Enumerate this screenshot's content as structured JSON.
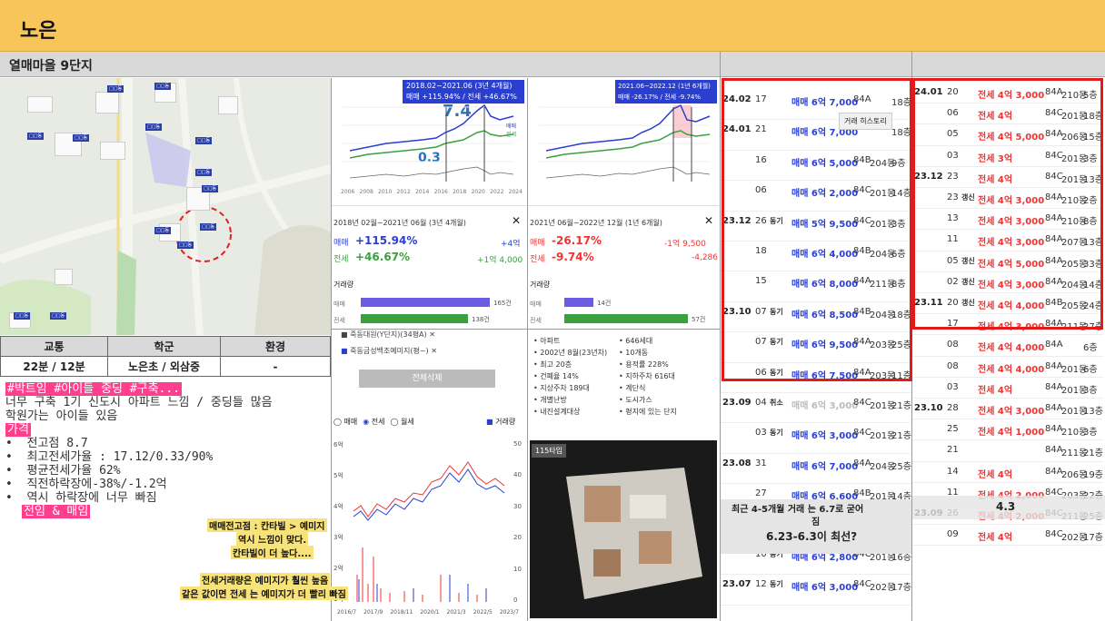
{
  "header": {
    "title": "노은"
  },
  "subbar": {
    "title": "열매마을 9단지"
  },
  "info_table": {
    "headers": [
      "교통",
      "학군",
      "환경"
    ],
    "values": [
      "22분 / 12분",
      "노은초 / 외삼중",
      "-"
    ]
  },
  "notes": {
    "tags": "#박트임 #아이들 중딩 #구축...",
    "line1": "너무 구축 1기 신도시 아파트 느낌 / 중딩들 많음",
    "line2": "학원가는 아이들 있음",
    "price_label": "가격",
    "bullets": [
      "전고점 8.7",
      "최고전세가율 : 17.12/0.33/90%",
      "평균전세가율 62%",
      "직전하락장에-38%/-1.2억",
      "역시 하락장에 너무 빠짐"
    ],
    "highlight": "전임 & 매임",
    "yellow1": "매매전고점 : 칸타빌 > 예미지",
    "yellow2": "역시 느낌이 맞다.",
    "yellow3": "칸타빌이 더 높다....",
    "yellow4": "전세거래량은 예미지가 훨씬 높음",
    "yellow5": "같은 값이면 전세 는 예미지가 더 빨리 빠짐"
  },
  "chart1": {
    "banner1": "2018.02~2021.06 (3년 4개월)",
    "banner2": "매매 +115.94% / 전세 +46.67%",
    "big1": "7.4",
    "big2": "0.3",
    "legend": [
      "매매",
      "전세"
    ],
    "xticks": [
      "2006",
      "2008",
      "2010",
      "2012",
      "2014",
      "2016",
      "2018",
      "2020",
      "2022",
      "2024"
    ],
    "period": "2018년 02월~2021년 06월 (3년 4개월)",
    "close": "✕",
    "sale_label": "매매",
    "sale_pct": "+115.94%",
    "sale_amt": "+4억",
    "rent_label": "전세",
    "rent_pct": "+46.67%",
    "rent_amt": "+1억 4,000",
    "volume_title": "거래량",
    "vol_sale": "165건",
    "vol_rent": "138건"
  },
  "chart2": {
    "banner1": "2021.06~2022.12 (1년 6개월)",
    "banner2": "매매 -26.17% / 전세 -9.74%",
    "period": "2021년 06월~2022년 12월 (1년 6개월)",
    "close": "✕",
    "sale_label": "매매",
    "sale_pct": "-26.17%",
    "sale_amt": "-1억 9,500",
    "rent_label": "전세",
    "rent_pct": "-9.74%",
    "rent_amt": "-4,286",
    "volume_title": "거래량",
    "vol_sale": "14건",
    "vol_rent": "57건"
  },
  "search_panel": {
    "chips": [
      "죽동대원(Y단지)(34평A) ✕",
      "죽동금성백조예미지(평~) ✕"
    ],
    "delete_all": "전체삭제",
    "radios": [
      "매매",
      "전세",
      "월세"
    ],
    "volume_check": "거래량",
    "yticks": [
      "6억",
      "5억",
      "4억",
      "3억",
      "2억",
      "1억"
    ],
    "yticks_r": [
      "50",
      "40",
      "30",
      "20",
      "10",
      "0"
    ],
    "xticks": [
      "2016/7",
      "2017/9",
      "2018/11",
      "2020/1",
      "2021/3",
      "2022/5",
      "2023/7"
    ]
  },
  "apt_info": {
    "left": [
      "아파트",
      "2002년 8월(23년차)",
      "최고 20층",
      "건폐율 14%",
      "지상주차 189대",
      "개별난방",
      "내진설계대상"
    ],
    "right": [
      "646세대",
      "10개동",
      "용적률 228%",
      "지하주차 616대",
      "계단식",
      "도시가스",
      "평지에 있는 단지"
    ],
    "plan_badge": "115타입"
  },
  "deals_left": {
    "tooltip": "거래 히스토리",
    "rows": [
      {
        "ym": "24.02",
        "d": "17",
        "tag": "",
        "price": "매매 6억 7,000",
        "type": "84A",
        "dong": "",
        "floor": "18층"
      },
      {
        "ym": "24.01",
        "d": "21",
        "tag": "",
        "price": "매매 6억 7,000",
        "type": "",
        "dong": "",
        "floor": "18층"
      },
      {
        "ym": "",
        "d": "16",
        "tag": "",
        "price": "매매 6억 5,000",
        "type": "84B",
        "dong": "204동",
        "floor": "9층"
      },
      {
        "ym": "",
        "d": "06",
        "tag": "",
        "price": "매매 6억 2,000",
        "type": "84C",
        "dong": "201동",
        "floor": "14층"
      },
      {
        "ym": "23.12",
        "d": "26",
        "tag": "동기",
        "price": "매매 5억 9,500",
        "type": "84C",
        "dong": "201동",
        "floor": "3층"
      },
      {
        "ym": "",
        "d": "18",
        "tag": "",
        "price": "매매 6억 4,000",
        "type": "84B",
        "dong": "204동",
        "floor": "6층"
      },
      {
        "ym": "",
        "d": "15",
        "tag": "",
        "price": "매매 6억 8,000",
        "type": "84A",
        "dong": "211동",
        "floor": "8층"
      },
      {
        "ym": "23.10",
        "d": "07",
        "tag": "동기",
        "price": "매매 6억 8,500",
        "type": "84B",
        "dong": "204동",
        "floor": "18층"
      },
      {
        "ym": "",
        "d": "07",
        "tag": "동기",
        "price": "매매 6억 9,500",
        "type": "84A",
        "dong": "203동",
        "floor": "25층"
      },
      {
        "ym": "",
        "d": "06",
        "tag": "동기",
        "price": "매매 6억 7,500",
        "type": "84A",
        "dong": "203동",
        "floor": "11층"
      },
      {
        "ym": "23.09",
        "d": "04",
        "tag": "취소",
        "price": "매매 6억 3,000",
        "type": "84C",
        "dong": "201동",
        "floor": "21층"
      },
      {
        "ym": "",
        "d": "03",
        "tag": "동기",
        "price": "매매 6억 3,000",
        "type": "84C",
        "dong": "201동",
        "floor": "21층"
      },
      {
        "ym": "23.08",
        "d": "31",
        "tag": "",
        "price": "매매 6억 7,000",
        "type": "84A",
        "dong": "204동",
        "floor": "25층"
      },
      {
        "ym": "",
        "d": "27",
        "tag": "",
        "price": "매매 6억 6,600",
        "type": "84B",
        "dong": "201동",
        "floor": "14층"
      },
      {
        "ym": "",
        "d": "",
        "tag": "",
        "price": "",
        "type": "",
        "dong": "211동",
        "floor": "5층"
      },
      {
        "ym": "",
        "d": "10",
        "tag": "동기",
        "price": "매매 6억 2,800",
        "type": "84C",
        "dong": "201동",
        "floor": "16층"
      },
      {
        "ym": "23.07",
        "d": "12",
        "tag": "동기",
        "price": "매매 6억 3,000",
        "type": "84C",
        "dong": "202동",
        "floor": "17층"
      }
    ],
    "note1": "최근 4-5개월 거래 는 6.7로 굳어",
    "note2": "짐",
    "note3": "6.23-6.3이 최선?"
  },
  "deals_right": {
    "rows": [
      {
        "ym": "24.01",
        "d": "20",
        "tag": "",
        "price": "전세 4억 3,000",
        "type": "84A",
        "dong": "210동",
        "floor": "5층"
      },
      {
        "ym": "",
        "d": "06",
        "tag": "",
        "price": "전세 4억",
        "type": "84C",
        "dong": "201동",
        "floor": "18층"
      },
      {
        "ym": "",
        "d": "05",
        "tag": "",
        "price": "전세 4억 5,000",
        "type": "84A",
        "dong": "206동",
        "floor": "15층"
      },
      {
        "ym": "",
        "d": "03",
        "tag": "",
        "price": "전세 3억",
        "type": "84C",
        "dong": "201동",
        "floor": "3층"
      },
      {
        "ym": "23.12",
        "d": "23",
        "tag": "",
        "price": "전세 4억",
        "type": "84C",
        "dong": "201동",
        "floor": "13층"
      },
      {
        "ym": "",
        "d": "23",
        "tag": "갱신",
        "price": "전세 4억 3,000",
        "type": "84A",
        "dong": "210동",
        "floor": "2층"
      },
      {
        "ym": "",
        "d": "13",
        "tag": "",
        "price": "전세 4억 3,000",
        "type": "84A",
        "dong": "210동",
        "floor": "8층"
      },
      {
        "ym": "",
        "d": "11",
        "tag": "",
        "price": "전세 4억 3,000",
        "type": "84A",
        "dong": "207동",
        "floor": "13층"
      },
      {
        "ym": "",
        "d": "05",
        "tag": "갱신",
        "price": "전세 4억 5,000",
        "type": "84A",
        "dong": "205동",
        "floor": "33층"
      },
      {
        "ym": "",
        "d": "02",
        "tag": "갱신",
        "price": "전세 4억 3,000",
        "type": "84A",
        "dong": "204동",
        "floor": "14층"
      },
      {
        "ym": "23.11",
        "d": "20",
        "tag": "갱신",
        "price": "전세 4억 4,000",
        "type": "84B",
        "dong": "205동",
        "floor": "24층"
      },
      {
        "ym": "",
        "d": "17",
        "tag": "",
        "price": "전세 4억 3,000",
        "type": "84A",
        "dong": "211동",
        "floor": "27층"
      },
      {
        "ym": "",
        "d": "08",
        "tag": "",
        "price": "전세 4억 4,000",
        "type": "84A",
        "dong": "",
        "floor": "6층"
      },
      {
        "ym": "",
        "d": "08",
        "tag": "",
        "price": "전세 4억 4,000",
        "type": "84A",
        "dong": "201동",
        "floor": "6층"
      },
      {
        "ym": "",
        "d": "03",
        "tag": "",
        "price": "전세 4억",
        "type": "84A",
        "dong": "201동",
        "floor": "3층"
      },
      {
        "ym": "23.10",
        "d": "28",
        "tag": "",
        "price": "전세 4억 3,000",
        "type": "84A",
        "dong": "201동",
        "floor": "13층"
      },
      {
        "ym": "",
        "d": "25",
        "tag": "",
        "price": "전세 4억 1,000",
        "type": "84A",
        "dong": "210동",
        "floor": "3층"
      },
      {
        "ym": "",
        "d": "21",
        "tag": "",
        "price": "",
        "type": "84A",
        "dong": "211동",
        "floor": "21층"
      },
      {
        "ym": "",
        "d": "14",
        "tag": "",
        "price": "전세 4억",
        "type": "84A",
        "dong": "206동",
        "floor": "19층"
      },
      {
        "ym": "",
        "d": "11",
        "tag": "",
        "price": "전세 4억 2,000",
        "type": "84C",
        "dong": "203동",
        "floor": "22층"
      },
      {
        "ym": "23.09",
        "d": "26",
        "tag": "",
        "price": "전세 4억 2,000",
        "type": "84C",
        "dong": "211동",
        "floor": "25층"
      },
      {
        "ym": "",
        "d": "09",
        "tag": "",
        "price": "전세 4억",
        "type": "84C",
        "dong": "202동",
        "floor": "17층"
      }
    ],
    "overlay": "4.3"
  }
}
